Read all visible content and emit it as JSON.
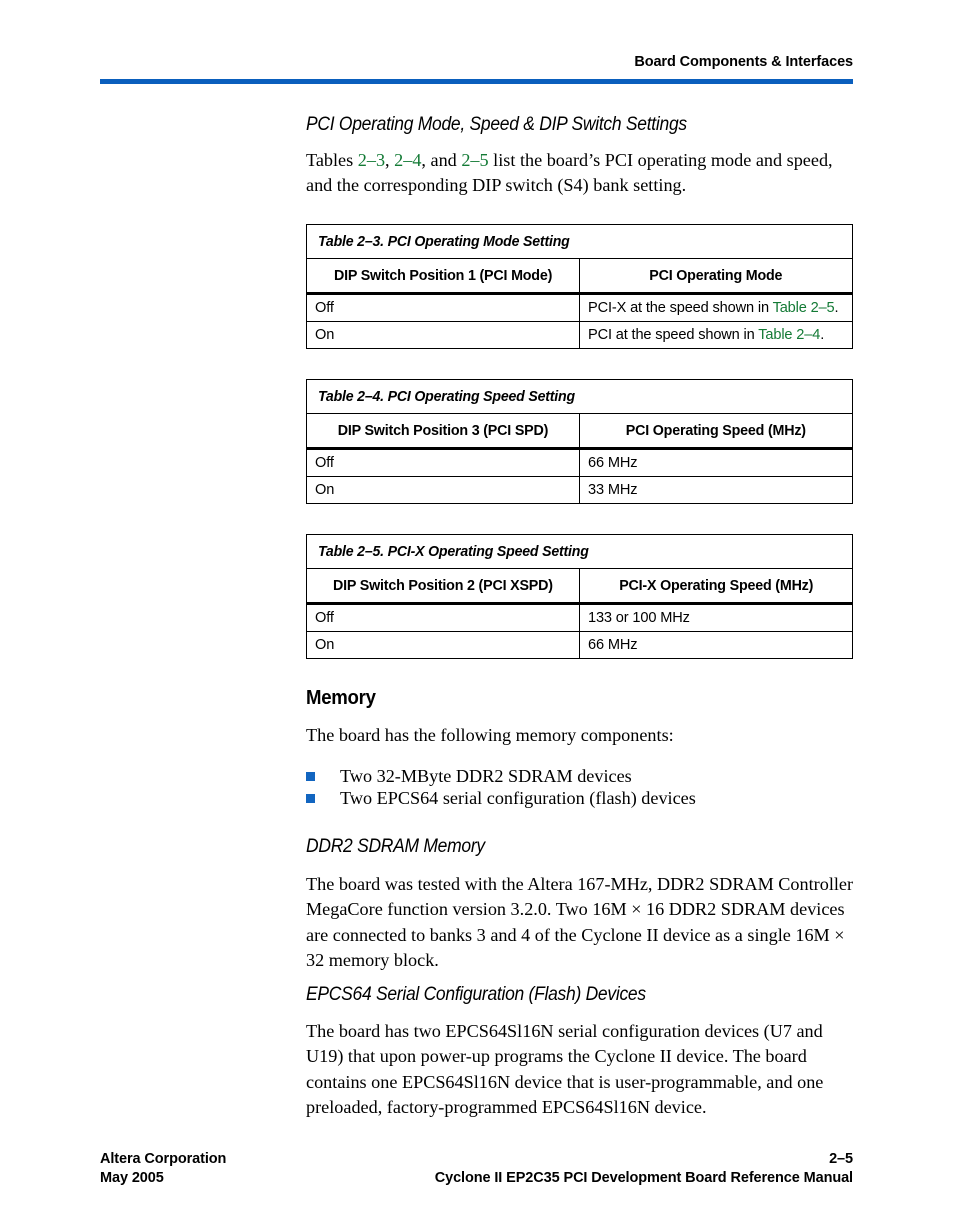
{
  "header": {
    "title": "Board Components & Interfaces",
    "rule_color": "#0a5fbd"
  },
  "section": {
    "heading": "PCI Operating Mode, Speed & DIP Switch Settings",
    "intro_1": "Tables ",
    "intro_xref_1": "2–3",
    "intro_2": ", ",
    "intro_xref_2": "2–4",
    "intro_3": ", and ",
    "intro_xref_3": "2–5",
    "intro_4": " list the board’s PCI operating mode and speed, and the corresponding DIP switch (S4) bank setting."
  },
  "tables": [
    {
      "title": "Table 2–3. PCI Operating Mode Setting",
      "headers": [
        "DIP Switch Position 1 (PCI Mode)",
        "PCI Operating Mode"
      ],
      "rows": [
        {
          "c0": "Off",
          "c1_pre": "PCI-X at the speed shown in ",
          "c1_xref": "Table 2–5",
          "c1_post": "."
        },
        {
          "c0": "On",
          "c1_pre": "PCI at the speed shown in ",
          "c1_xref": "Table 2–4",
          "c1_post": "."
        }
      ]
    },
    {
      "title": "Table 2–4. PCI Operating Speed Setting",
      "headers": [
        "DIP Switch Position 3 (PCI SPD)",
        "PCI Operating Speed (MHz)"
      ],
      "rows": [
        {
          "c0": "Off",
          "c1_pre": "66 MHz",
          "c1_xref": "",
          "c1_post": ""
        },
        {
          "c0": "On",
          "c1_pre": "33 MHz",
          "c1_xref": "",
          "c1_post": ""
        }
      ]
    },
    {
      "title": "Table 2–5. PCI-X Operating Speed Setting",
      "headers": [
        "DIP Switch Position 2 (PCI XSPD)",
        "PCI-X Operating Speed (MHz)"
      ],
      "rows": [
        {
          "c0": "Off",
          "c1_pre": "133 or 100 MHz",
          "c1_xref": "",
          "c1_post": ""
        },
        {
          "c0": "On",
          "c1_pre": "66 MHz",
          "c1_xref": "",
          "c1_post": ""
        }
      ]
    }
  ],
  "memory": {
    "heading": "Memory",
    "intro": "The board has the following memory components:",
    "bullets": [
      "Two 32-MByte DDR2 SDRAM devices",
      "Two EPCS64 serial configuration (flash) devices"
    ]
  },
  "ddr2": {
    "heading": "DDR2 SDRAM Memory",
    "body": "The board was tested with the Altera 167-MHz, DDR2 SDRAM Controller MegaCore function version 3.2.0. Two 16M × 16 DDR2 SDRAM devices are connected to banks 3 and 4 of the Cyclone II device as a single 16M × 32 memory block."
  },
  "epcs64": {
    "heading": "EPCS64 Serial Configuration (Flash) Devices",
    "body": "The board has two EPCS64Sl16N serial configuration devices (U7 and U19) that upon power-up programs the Cyclone II device. The board contains one EPCS64Sl16N device that is user-programmable, and one preloaded, factory-programmed EPCS64Sl16N device."
  },
  "footer": {
    "company": "Altera Corporation",
    "date": "May 2005",
    "page_number": "2–5",
    "manual_title": "Cyclone II EP2C35 PCI Development Board Reference Manual"
  }
}
